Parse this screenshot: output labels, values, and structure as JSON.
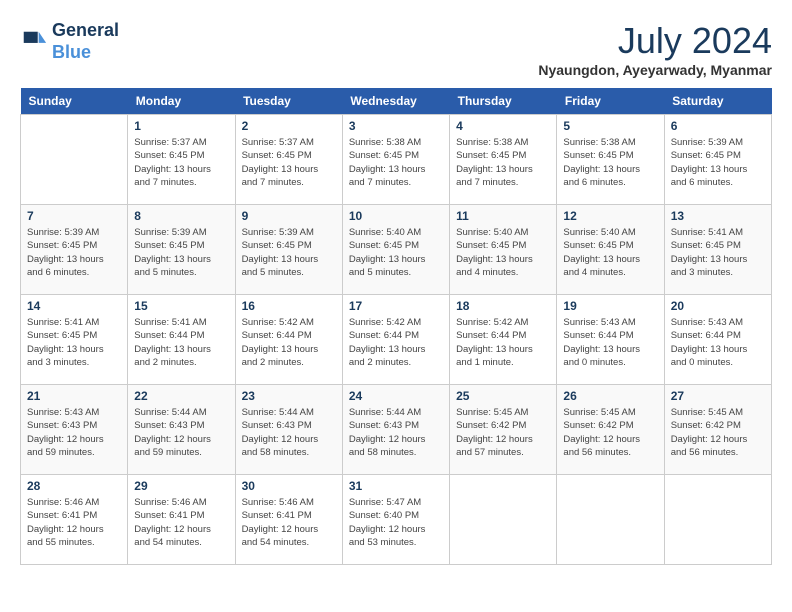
{
  "header": {
    "logo_line1": "General",
    "logo_line2": "Blue",
    "month_year": "July 2024",
    "location": "Nyaungdon, Ayeyarwady, Myanmar"
  },
  "calendar": {
    "weekdays": [
      "Sunday",
      "Monday",
      "Tuesday",
      "Wednesday",
      "Thursday",
      "Friday",
      "Saturday"
    ],
    "weeks": [
      [
        {
          "num": "",
          "info": ""
        },
        {
          "num": "1",
          "info": "Sunrise: 5:37 AM\nSunset: 6:45 PM\nDaylight: 13 hours\nand 7 minutes."
        },
        {
          "num": "2",
          "info": "Sunrise: 5:37 AM\nSunset: 6:45 PM\nDaylight: 13 hours\nand 7 minutes."
        },
        {
          "num": "3",
          "info": "Sunrise: 5:38 AM\nSunset: 6:45 PM\nDaylight: 13 hours\nand 7 minutes."
        },
        {
          "num": "4",
          "info": "Sunrise: 5:38 AM\nSunset: 6:45 PM\nDaylight: 13 hours\nand 7 minutes."
        },
        {
          "num": "5",
          "info": "Sunrise: 5:38 AM\nSunset: 6:45 PM\nDaylight: 13 hours\nand 6 minutes."
        },
        {
          "num": "6",
          "info": "Sunrise: 5:39 AM\nSunset: 6:45 PM\nDaylight: 13 hours\nand 6 minutes."
        }
      ],
      [
        {
          "num": "7",
          "info": "Sunrise: 5:39 AM\nSunset: 6:45 PM\nDaylight: 13 hours\nand 6 minutes."
        },
        {
          "num": "8",
          "info": "Sunrise: 5:39 AM\nSunset: 6:45 PM\nDaylight: 13 hours\nand 5 minutes."
        },
        {
          "num": "9",
          "info": "Sunrise: 5:39 AM\nSunset: 6:45 PM\nDaylight: 13 hours\nand 5 minutes."
        },
        {
          "num": "10",
          "info": "Sunrise: 5:40 AM\nSunset: 6:45 PM\nDaylight: 13 hours\nand 5 minutes."
        },
        {
          "num": "11",
          "info": "Sunrise: 5:40 AM\nSunset: 6:45 PM\nDaylight: 13 hours\nand 4 minutes."
        },
        {
          "num": "12",
          "info": "Sunrise: 5:40 AM\nSunset: 6:45 PM\nDaylight: 13 hours\nand 4 minutes."
        },
        {
          "num": "13",
          "info": "Sunrise: 5:41 AM\nSunset: 6:45 PM\nDaylight: 13 hours\nand 3 minutes."
        }
      ],
      [
        {
          "num": "14",
          "info": "Sunrise: 5:41 AM\nSunset: 6:45 PM\nDaylight: 13 hours\nand 3 minutes."
        },
        {
          "num": "15",
          "info": "Sunrise: 5:41 AM\nSunset: 6:44 PM\nDaylight: 13 hours\nand 2 minutes."
        },
        {
          "num": "16",
          "info": "Sunrise: 5:42 AM\nSunset: 6:44 PM\nDaylight: 13 hours\nand 2 minutes."
        },
        {
          "num": "17",
          "info": "Sunrise: 5:42 AM\nSunset: 6:44 PM\nDaylight: 13 hours\nand 2 minutes."
        },
        {
          "num": "18",
          "info": "Sunrise: 5:42 AM\nSunset: 6:44 PM\nDaylight: 13 hours\nand 1 minute."
        },
        {
          "num": "19",
          "info": "Sunrise: 5:43 AM\nSunset: 6:44 PM\nDaylight: 13 hours\nand 0 minutes."
        },
        {
          "num": "20",
          "info": "Sunrise: 5:43 AM\nSunset: 6:44 PM\nDaylight: 13 hours\nand 0 minutes."
        }
      ],
      [
        {
          "num": "21",
          "info": "Sunrise: 5:43 AM\nSunset: 6:43 PM\nDaylight: 12 hours\nand 59 minutes."
        },
        {
          "num": "22",
          "info": "Sunrise: 5:44 AM\nSunset: 6:43 PM\nDaylight: 12 hours\nand 59 minutes."
        },
        {
          "num": "23",
          "info": "Sunrise: 5:44 AM\nSunset: 6:43 PM\nDaylight: 12 hours\nand 58 minutes."
        },
        {
          "num": "24",
          "info": "Sunrise: 5:44 AM\nSunset: 6:43 PM\nDaylight: 12 hours\nand 58 minutes."
        },
        {
          "num": "25",
          "info": "Sunrise: 5:45 AM\nSunset: 6:42 PM\nDaylight: 12 hours\nand 57 minutes."
        },
        {
          "num": "26",
          "info": "Sunrise: 5:45 AM\nSunset: 6:42 PM\nDaylight: 12 hours\nand 56 minutes."
        },
        {
          "num": "27",
          "info": "Sunrise: 5:45 AM\nSunset: 6:42 PM\nDaylight: 12 hours\nand 56 minutes."
        }
      ],
      [
        {
          "num": "28",
          "info": "Sunrise: 5:46 AM\nSunset: 6:41 PM\nDaylight: 12 hours\nand 55 minutes."
        },
        {
          "num": "29",
          "info": "Sunrise: 5:46 AM\nSunset: 6:41 PM\nDaylight: 12 hours\nand 54 minutes."
        },
        {
          "num": "30",
          "info": "Sunrise: 5:46 AM\nSunset: 6:41 PM\nDaylight: 12 hours\nand 54 minutes."
        },
        {
          "num": "31",
          "info": "Sunrise: 5:47 AM\nSunset: 6:40 PM\nDaylight: 12 hours\nand 53 minutes."
        },
        {
          "num": "",
          "info": ""
        },
        {
          "num": "",
          "info": ""
        },
        {
          "num": "",
          "info": ""
        }
      ]
    ]
  }
}
